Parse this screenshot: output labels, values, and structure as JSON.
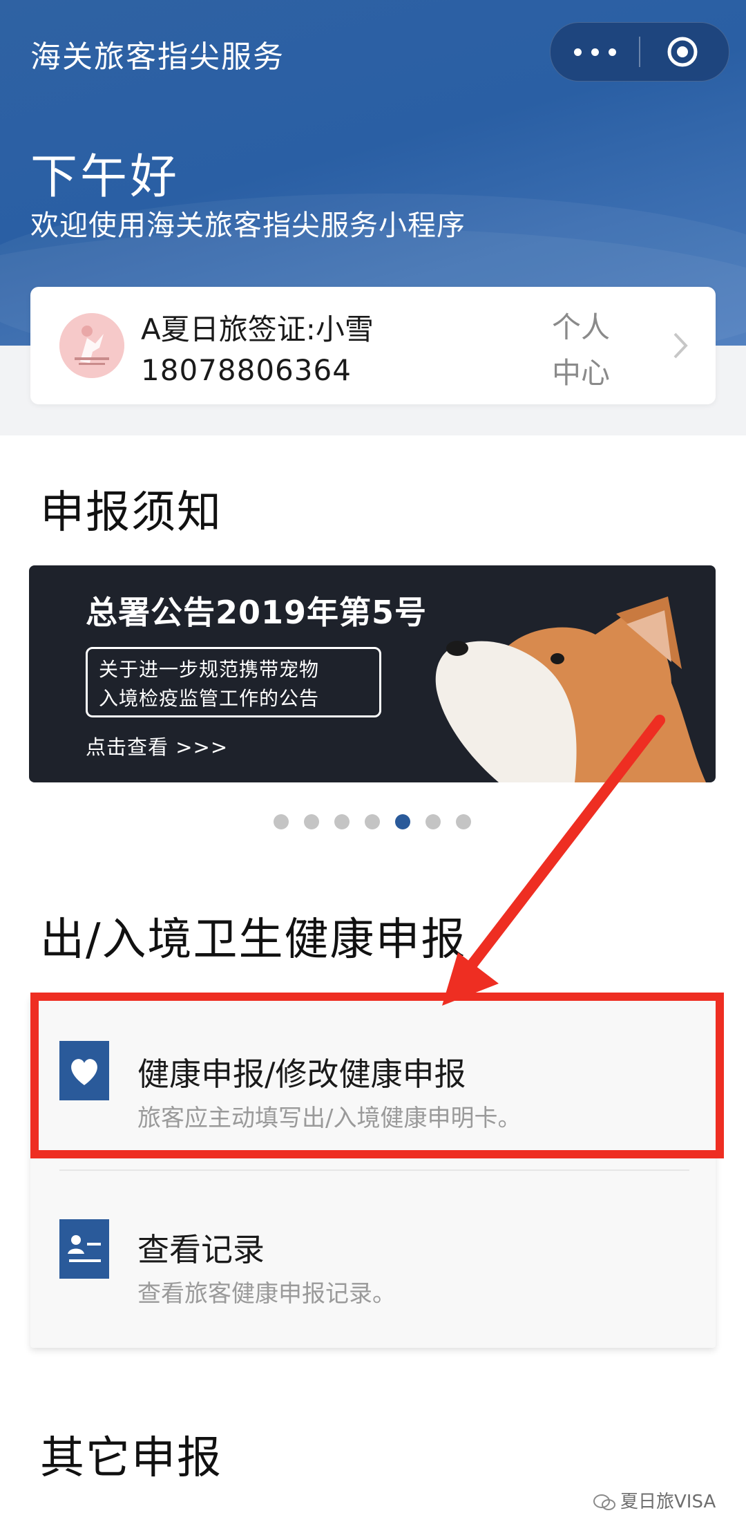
{
  "app": {
    "title": "海关旅客指尖服务",
    "greeting": "下午好",
    "welcome": "欢迎使用海关旅客指尖服务小程序"
  },
  "user": {
    "name": "A夏日旅签证:小雪",
    "phone": "18078806364",
    "center_link": "个人中心"
  },
  "notice": {
    "title": "申报须知",
    "banner": {
      "headline": "总署公告2019年第5号",
      "line1": "关于进一步规范携带宠物",
      "line2": "入境检疫监管工作的公告",
      "cta": "点击查看 >>>"
    },
    "carousel": {
      "total": 7,
      "active_index": 4
    }
  },
  "health": {
    "title": "出/入境卫生健康申报",
    "items": [
      {
        "title": "健康申报/修改健康申报",
        "subtitle": "旅客应主动填写出/入境健康申明卡。",
        "icon": "heart-icon"
      },
      {
        "title": "查看记录",
        "subtitle": "查看旅客健康申报记录。",
        "icon": "record-list-icon"
      }
    ]
  },
  "other": {
    "title": "其它申报"
  },
  "watermark": "夏日旅VISA",
  "colors": {
    "header_blue": "#2f62a3",
    "icon_blue": "#2a5a9a",
    "annotation_red": "#ee2e22",
    "banner_dark": "#1e222b"
  }
}
